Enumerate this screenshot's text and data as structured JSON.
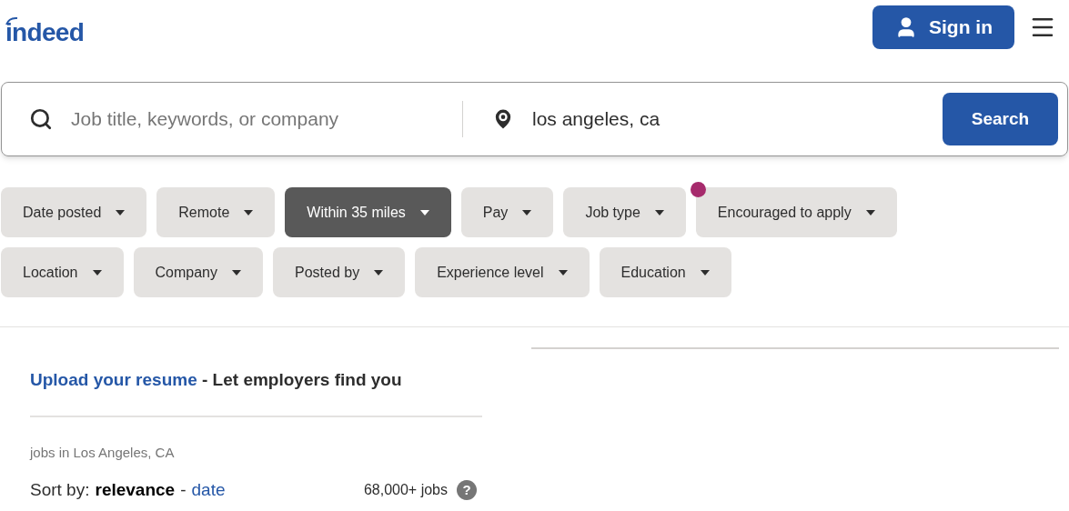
{
  "header": {
    "logo": "indeed",
    "sign_in": "Sign in"
  },
  "search": {
    "what_placeholder": "Job title, keywords, or company",
    "where_value": "los angeles, ca",
    "button": "Search"
  },
  "filters": [
    [
      {
        "label": "Date posted",
        "selected": false,
        "new_dot": false
      },
      {
        "label": "Remote",
        "selected": false,
        "new_dot": false
      },
      {
        "label": "Within 35 miles",
        "selected": true,
        "new_dot": false
      },
      {
        "label": "Pay",
        "selected": false,
        "new_dot": false
      },
      {
        "label": "Job type",
        "selected": false,
        "new_dot": false
      },
      {
        "label": "Encouraged to apply",
        "selected": false,
        "new_dot": true
      }
    ],
    [
      {
        "label": "Location",
        "selected": false,
        "new_dot": false
      },
      {
        "label": "Company",
        "selected": false,
        "new_dot": false
      },
      {
        "label": "Posted by",
        "selected": false,
        "new_dot": false
      },
      {
        "label": "Experience level",
        "selected": false,
        "new_dot": false
      },
      {
        "label": "Education",
        "selected": false,
        "new_dot": false
      }
    ]
  ],
  "resume": {
    "link": "Upload your resume",
    "text": "- Let employers find you"
  },
  "results": {
    "heading": "jobs in Los Angeles, CA",
    "sort_label": "Sort by:",
    "separator": "-",
    "sort_options": [
      {
        "label": "relevance",
        "selected": true
      },
      {
        "label": "date",
        "selected": false
      }
    ],
    "count": "68,000+ jobs",
    "help": "?"
  }
}
